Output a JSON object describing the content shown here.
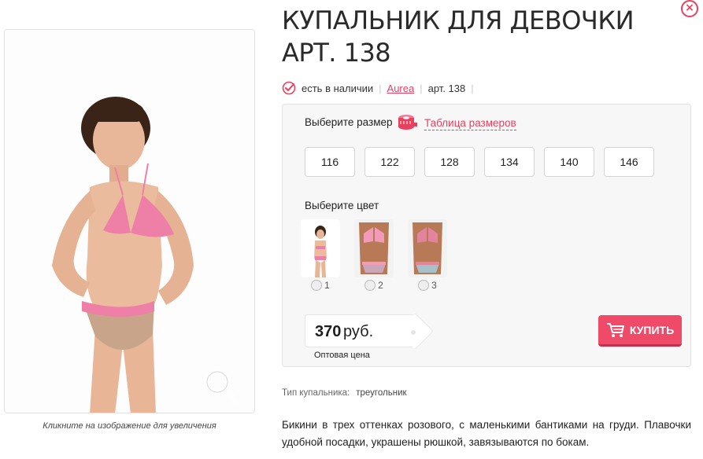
{
  "product": {
    "title": "КУПАЛЬНИК ДЛЯ ДЕВОЧКИ АРТ. 138",
    "availability": "есть в наличии",
    "brand": "Aurea",
    "article": "арт. 138"
  },
  "image": {
    "caption": "Кликните на изображение для увеличения"
  },
  "close": {
    "label": "×"
  },
  "sizes": {
    "label": "Выберите размер",
    "table_link": "Таблица размеров",
    "options": [
      "116",
      "122",
      "128",
      "134",
      "140",
      "146"
    ]
  },
  "colors": {
    "label": "Выберите цвет",
    "options": [
      "1",
      "2",
      "3"
    ]
  },
  "price": {
    "amount": "370",
    "currency": "руб.",
    "note": "Оптовая цена"
  },
  "buy": {
    "label": "КУПИТЬ"
  },
  "spec": {
    "name": "Тип купальника:",
    "value": "треугольник"
  },
  "description": "Бикини в трех оттенках розового, с маленькими бантиками на груди. Плавочки удобной посадки, украшены рюшкой, завязываются по бокам.",
  "colors_palette": {
    "accent": "#e8415e",
    "buy_button": "#ef4a68",
    "panel_bg": "#f7f7f7"
  },
  "icons": [
    "close-icon",
    "check-circle-icon",
    "measuring-tape-icon",
    "zoom-icon",
    "cart-icon"
  ]
}
